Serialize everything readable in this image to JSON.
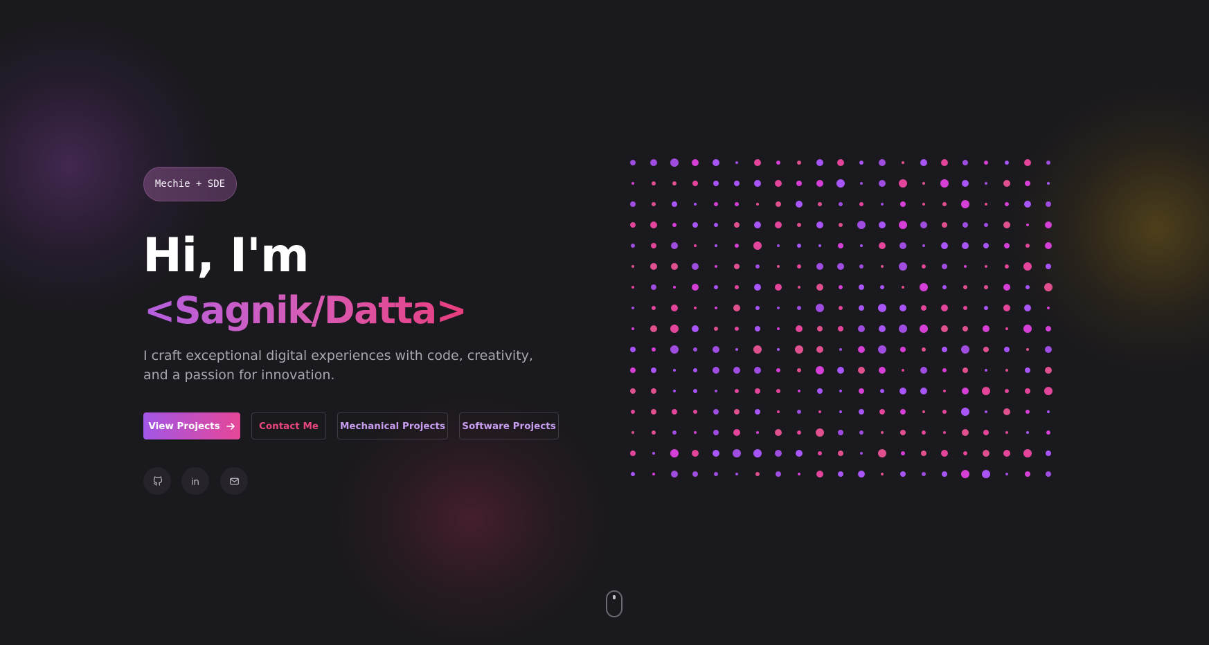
{
  "hero": {
    "badge": "Mechie + SDE",
    "greeting": "Hi, I'm",
    "name": "<Sagnik/Datta>",
    "tagline": "I craft exceptional digital experiences with code, creativity, and a passion for innovation."
  },
  "buttons": {
    "view_projects": "View Projects",
    "contact": "Contact Me",
    "mechanical": "Mechanical Projects",
    "software": "Software Projects"
  },
  "icons": {
    "view_projects_arrow": "arrow-right-icon",
    "github": "github-icon",
    "linkedin": "linkedin-icon",
    "email": "mail-icon",
    "scroll": "mouse-scroll-icon"
  },
  "theme": {
    "background": "#1a191d",
    "accent_purple": "#a256e6",
    "accent_pink": "#e64796",
    "dot_colors": [
      "#e3459a",
      "#d63fd6",
      "#a855f7",
      "#9f4de0",
      "#e0508f"
    ]
  }
}
